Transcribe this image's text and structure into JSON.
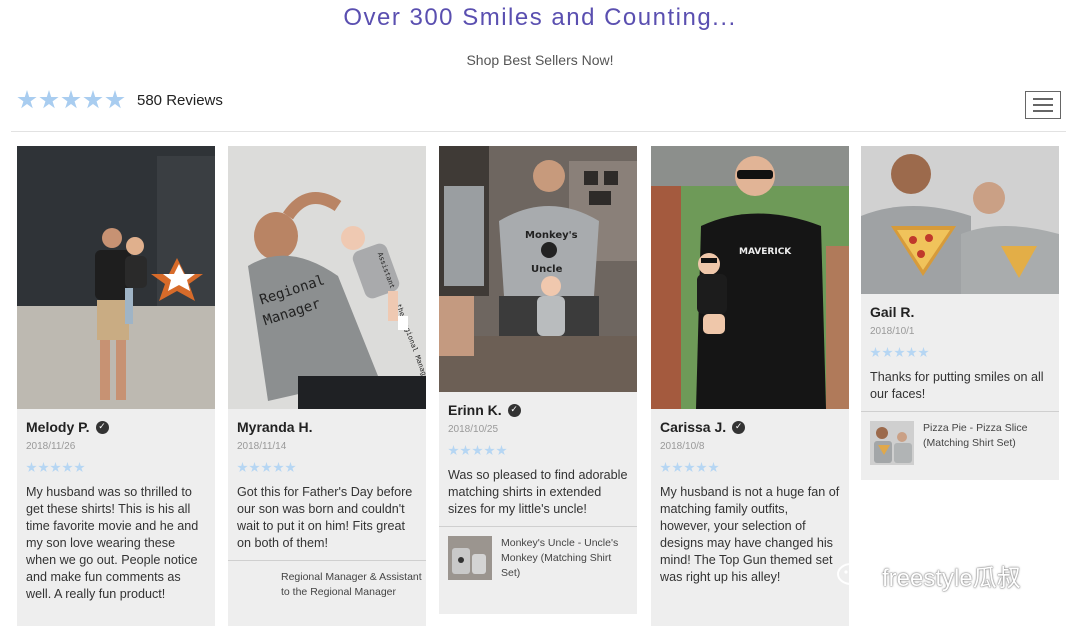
{
  "header": {
    "headline": "Over 300 Smiles and Counting...",
    "subline": "Shop Best Sellers Now!"
  },
  "rating": {
    "stars": 5,
    "reviews_label": "580 Reviews"
  },
  "menu": {
    "icon": "hamburger-icon"
  },
  "colors": {
    "accent": "#5a4fb0",
    "star": "#a9cdf0",
    "card_bg": "#eeeeee"
  },
  "reviews": [
    {
      "name": "Melody P.",
      "verified": true,
      "date": "2018/11/26",
      "rating": 5,
      "text": "My husband was so thrilled to get these shirts! This is his all time favorite movie and he and my son love wearing these when we go out. People notice and make fun comments as well. A really fun product!"
    },
    {
      "name": "Myranda H.",
      "verified": false,
      "date": "2018/11/14",
      "rating": 5,
      "text": "Got this for Father's Day before our son was born and couldn't wait to put it on him! Fits great on both of them!",
      "product": "Regional Manager & Assistant to the Regional Manager"
    },
    {
      "name": "Erinn K.",
      "verified": true,
      "date": "2018/10/25",
      "rating": 5,
      "text": "Was so pleased to find adorable matching shirts in extended sizes for my little's uncle!",
      "product": "Monkey's Uncle - Uncle's Monkey (Matching Shirt Set)"
    },
    {
      "name": "Carissa J.",
      "verified": true,
      "date": "2018/10/8",
      "rating": 5,
      "text": "My husband is not a huge fan of matching family outfits, however, your selection of designs may have changed his mind! The Top Gun themed set was right up his alley!"
    },
    {
      "name": "Gail R.",
      "verified": false,
      "date": "2018/10/1",
      "rating": 5,
      "text": "Thanks for putting smiles on all our faces!",
      "product": "Pizza Pie - Pizza Slice (Matching Shirt Set)"
    }
  ],
  "watermark": "freestyle瓜叔"
}
